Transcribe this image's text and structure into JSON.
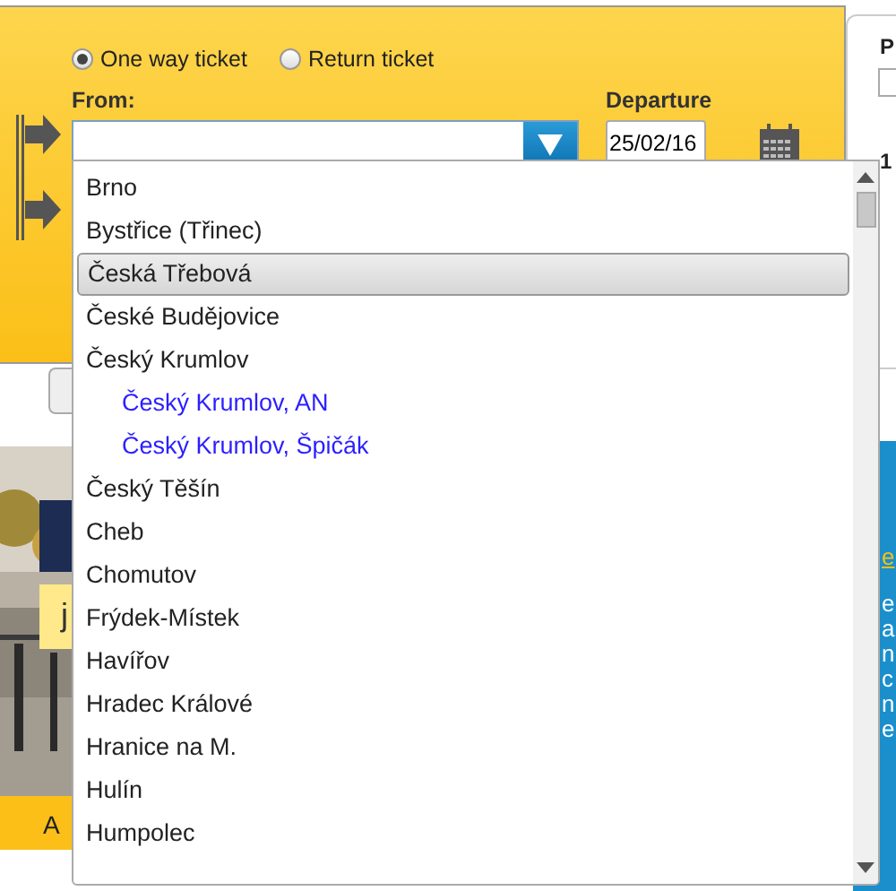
{
  "trip_type": [
    {
      "label": "One way ticket",
      "selected": true
    },
    {
      "label": "Return ticket",
      "selected": false
    }
  ],
  "from": {
    "label": "From:"
  },
  "departure": {
    "label": "Departure",
    "value": "25/02/16"
  },
  "dropdown": {
    "items": [
      {
        "label": "Brno",
        "selected": false
      },
      {
        "label": "Bystřice (Třinec)",
        "selected": false
      },
      {
        "label": "Česká Třebová",
        "selected": true
      },
      {
        "label": "České Budějovice",
        "selected": false
      },
      {
        "label": "Český Krumlov",
        "selected": false,
        "children": [
          {
            "label": "Český Krumlov, AN",
            "selected": false
          },
          {
            "label": "Český Krumlov, Špičák",
            "selected": false
          }
        ]
      },
      {
        "label": "Český Těšín",
        "selected": false
      },
      {
        "label": "Cheb",
        "selected": false
      },
      {
        "label": "Chomutov",
        "selected": false
      },
      {
        "label": "Frýdek-Místek",
        "selected": false
      },
      {
        "label": "Havířov",
        "selected": false
      },
      {
        "label": "Hradec Králové",
        "selected": false
      },
      {
        "label": "Hranice na M.",
        "selected": false
      },
      {
        "label": "Hulín",
        "selected": false
      },
      {
        "label": "Humpolec",
        "selected": false
      }
    ]
  },
  "side_panel": {
    "fragments": [
      "P",
      "1"
    ]
  },
  "banner": {
    "subtitle": "j",
    "footer": "A"
  },
  "info_panel": {
    "link": "e",
    "lines": [
      "e",
      "a",
      "n",
      "c",
      "n",
      "e"
    ]
  }
}
